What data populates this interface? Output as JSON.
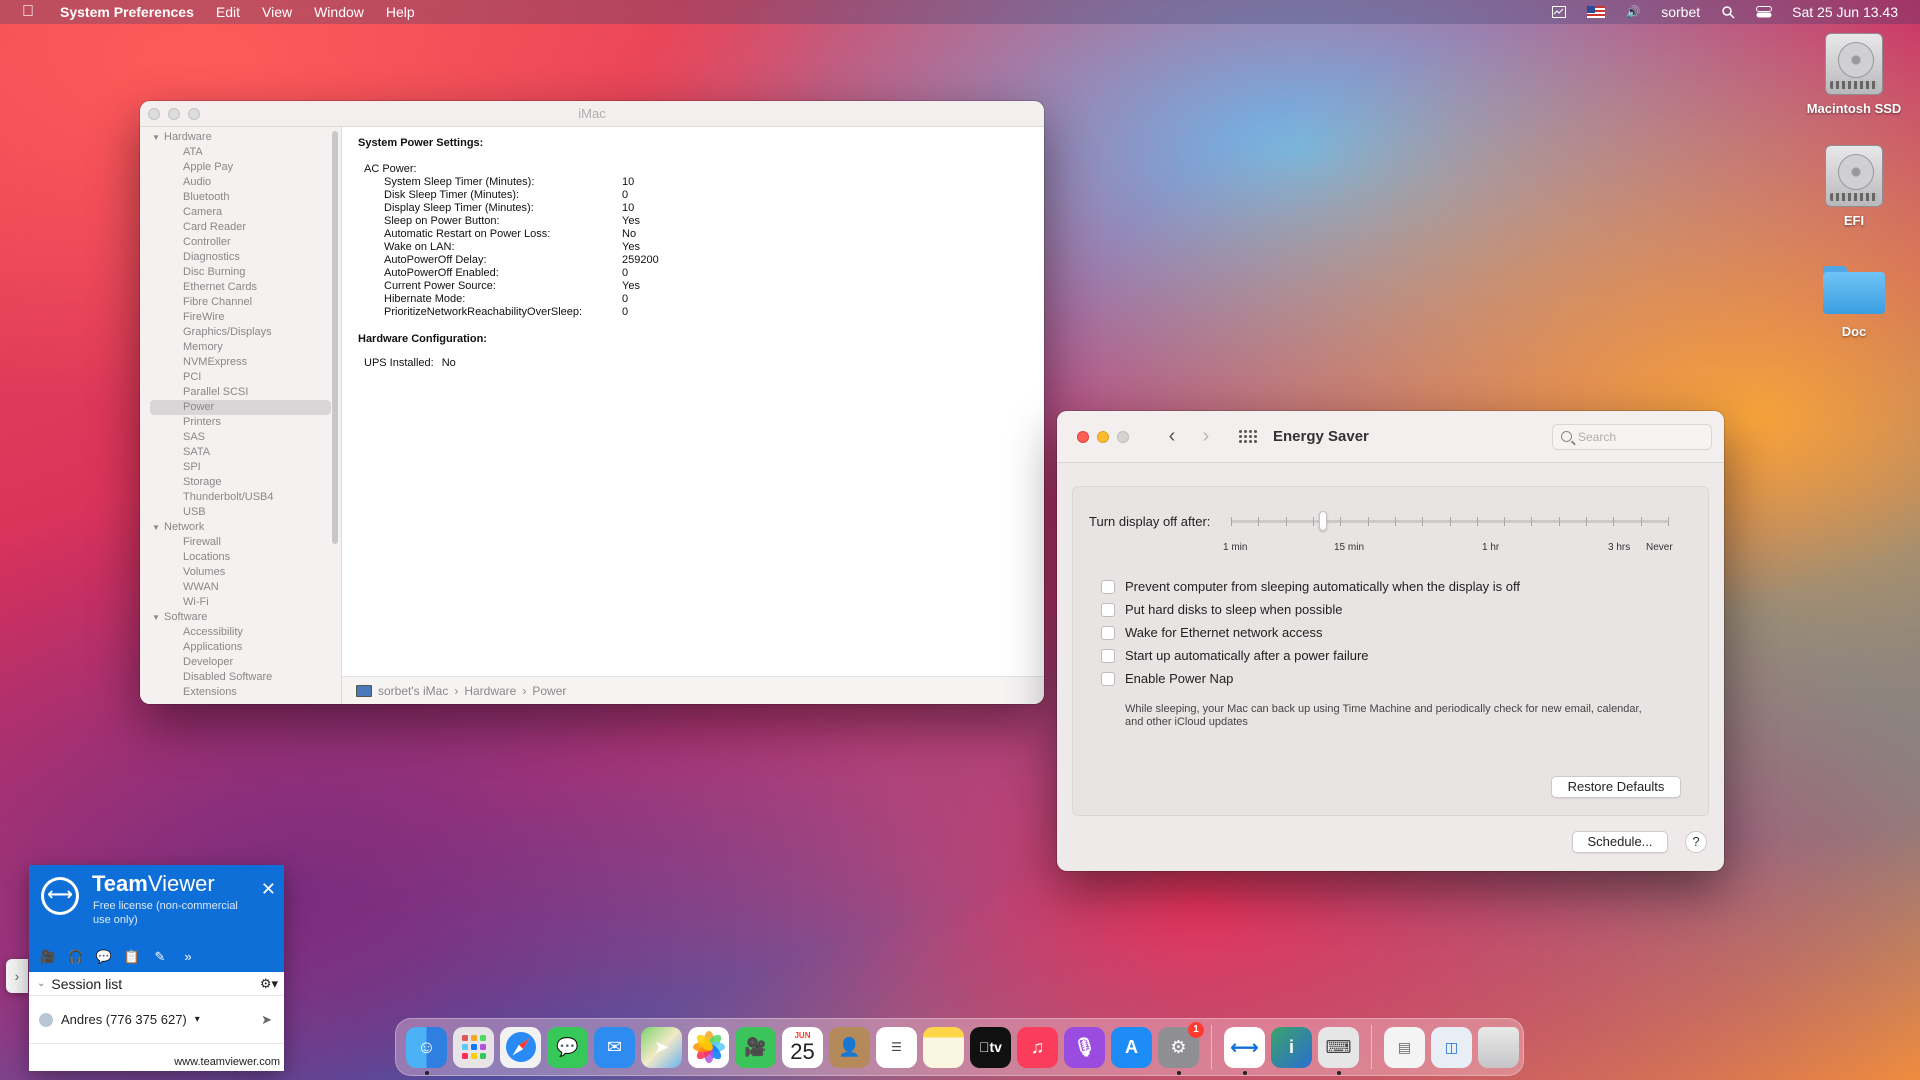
{
  "menubar": {
    "app_name": "System Preferences",
    "menus": [
      "Edit",
      "View",
      "Window",
      "Help"
    ],
    "user": "sorbet",
    "clock": "Sat 25 Jun  13.43"
  },
  "desktop": {
    "icons": [
      "Macintosh SSD",
      "EFI",
      "Doc"
    ]
  },
  "sysinfo": {
    "title": "iMac",
    "sidebar": {
      "hardware": "Hardware",
      "hardware_items": [
        "ATA",
        "Apple Pay",
        "Audio",
        "Bluetooth",
        "Camera",
        "Card Reader",
        "Controller",
        "Diagnostics",
        "Disc Burning",
        "Ethernet Cards",
        "Fibre Channel",
        "FireWire",
        "Graphics/Displays",
        "Memory",
        "NVMExpress",
        "PCI",
        "Parallel SCSI",
        "Power",
        "Printers",
        "SAS",
        "SATA",
        "SPI",
        "Storage",
        "Thunderbolt/USB4",
        "USB"
      ],
      "network": "Network",
      "network_items": [
        "Firewall",
        "Locations",
        "Volumes",
        "WWAN",
        "Wi-Fi"
      ],
      "software": "Software",
      "software_items": [
        "Accessibility",
        "Applications",
        "Developer",
        "Disabled Software",
        "Extensions"
      ]
    },
    "content": {
      "heading": "System Power Settings:",
      "ac_power_label": "AC Power:",
      "settings": [
        {
          "k": "System Sleep Timer (Minutes):",
          "v": "10"
        },
        {
          "k": "Disk Sleep Timer (Minutes):",
          "v": "0"
        },
        {
          "k": "Display Sleep Timer (Minutes):",
          "v": "10"
        },
        {
          "k": "Sleep on Power Button:",
          "v": "Yes"
        },
        {
          "k": "Automatic Restart on Power Loss:",
          "v": "No"
        },
        {
          "k": "Wake on LAN:",
          "v": "Yes"
        },
        {
          "k": "AutoPowerOff Delay:",
          "v": "259200"
        },
        {
          "k": "AutoPowerOff Enabled:",
          "v": "0"
        },
        {
          "k": "Current Power Source:",
          "v": "Yes"
        },
        {
          "k": "Hibernate Mode:",
          "v": "0"
        },
        {
          "k": "PrioritizeNetworkReachabilityOverSleep:",
          "v": "0"
        }
      ],
      "hw_heading": "Hardware Configuration:",
      "ups_label": "UPS Installed:",
      "ups_value": "No"
    },
    "breadcrumb": [
      "sorbet's iMac",
      "Hardware",
      "Power"
    ]
  },
  "energy": {
    "title": "Energy Saver",
    "search_placeholder": "Search",
    "slider_label": "Turn display off after:",
    "slider_ticks": [
      "1 min",
      "15 min",
      "1 hr",
      "3 hrs",
      "Never"
    ],
    "slider_value": "10 min",
    "options": [
      "Prevent computer from sleeping automatically when the display is off",
      "Put hard disks to sleep when possible",
      "Wake for Ethernet network access",
      "Start up automatically after a power failure",
      "Enable Power Nap"
    ],
    "power_nap_desc": "While sleeping, your Mac can back up using Time Machine and periodically check for new email, calendar, and other iCloud updates",
    "restore_label": "Restore Defaults",
    "schedule_label": "Schedule...",
    "help_label": "?"
  },
  "teamviewer": {
    "brand_a": "Team",
    "brand_b": "Viewer",
    "license": "Free license (non-commercial use only)",
    "session_list": "Session list",
    "contact": "Andres (776 375 627)",
    "url": "www.teamviewer.com"
  },
  "dock": {
    "calendar_month": "JUN",
    "calendar_day": "25",
    "settings_badge": "1"
  }
}
